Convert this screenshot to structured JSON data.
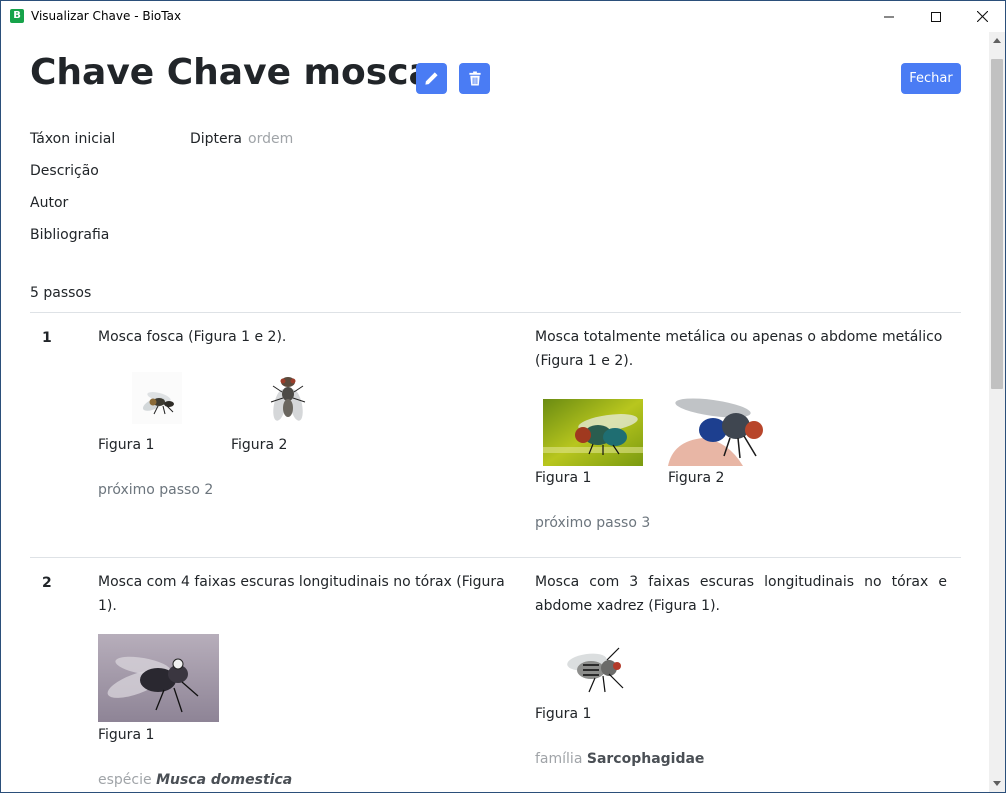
{
  "window": {
    "title": "Visualizar Chave - BioTax",
    "app_icon_letter": "B"
  },
  "header": {
    "title": "Chave Chave mosca",
    "close_label": "Fechar"
  },
  "meta": {
    "taxon_label": "Táxon inicial",
    "taxon_value": "Diptera",
    "taxon_rank": "ordem",
    "description_label": "Descrição",
    "author_label": "Autor",
    "bibliography_label": "Bibliografia"
  },
  "steps_count": "5 passos",
  "steps": [
    {
      "number": "1",
      "left": {
        "text": "Mosca fosca (Figura 1 e 2).",
        "figures": [
          "Figura 1",
          "Figura 2"
        ],
        "next": "próximo passo 2"
      },
      "right": {
        "text": "Mosca totalmente metálica ou apenas o abdome metálico (Figura 1 e 2).",
        "figures": [
          "Figura 1",
          "Figura 2"
        ],
        "next": "próximo passo 3"
      }
    },
    {
      "number": "2",
      "left": {
        "text": "Mosca com 4 faixas escuras longitudinais no tórax (Figura 1).",
        "figures": [
          "Figura 1"
        ],
        "rank": "espécie",
        "taxon": "Musca domestica"
      },
      "right": {
        "text": "Mosca com 3 faixas escuras longitudinais no tórax e abdome xadrez (Figura 1).",
        "figures": [
          "Figura 1"
        ],
        "rank": "família",
        "taxon": "Sarcophagidae"
      }
    }
  ],
  "colors": {
    "primary": "#4a7cf4",
    "muted": "#6c757d",
    "divider": "#dee2e6"
  }
}
